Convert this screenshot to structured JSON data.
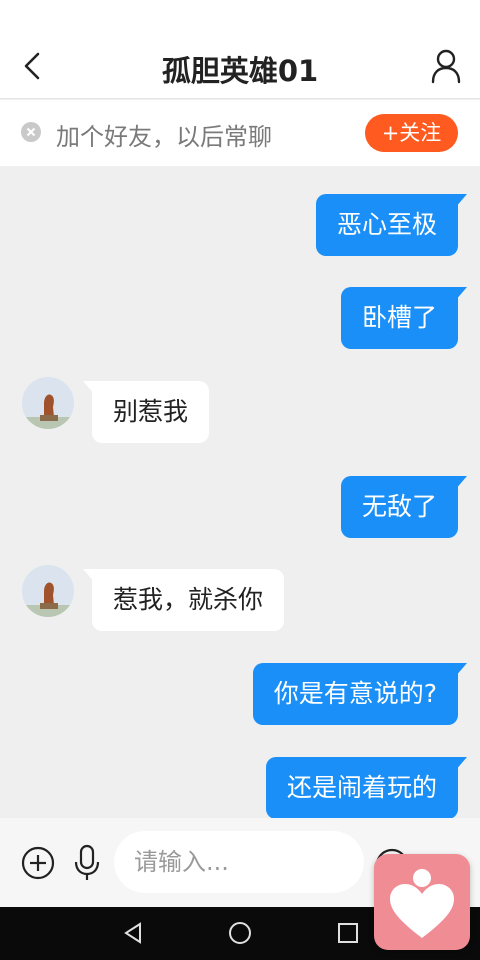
{
  "header": {
    "title": "孤胆英雄01",
    "back_icon": "chevron-left-icon",
    "profile_icon": "person-icon"
  },
  "friend_bar": {
    "text": "加个好友，以后常聊",
    "follow_label": "+关注",
    "dismiss_icon": "close-circle-icon"
  },
  "messages": [
    {
      "side": "out",
      "text": "恶心至极"
    },
    {
      "side": "out",
      "text": "卧槽了"
    },
    {
      "side": "in",
      "text": "别惹我"
    },
    {
      "side": "out",
      "text": "无敌了"
    },
    {
      "side": "in",
      "text": "惹我，就杀你"
    },
    {
      "side": "out",
      "text": "你是有意说的?"
    },
    {
      "side": "out",
      "text": "还是闹着玩的"
    }
  ],
  "input_bar": {
    "placeholder": "请输入...",
    "plus_icon": "plus-circle-icon",
    "mic_icon": "microphone-icon",
    "emoji_icon": "emoji-icon"
  },
  "nav": {
    "back_icon": "nav-back-triangle-icon",
    "home_icon": "nav-home-circle-icon",
    "recent_icon": "nav-recent-square-icon"
  },
  "colors": {
    "accent_blue": "#1a8ff7",
    "follow_orange": "#ff5a1f",
    "floating_pink": "#f08d94"
  }
}
